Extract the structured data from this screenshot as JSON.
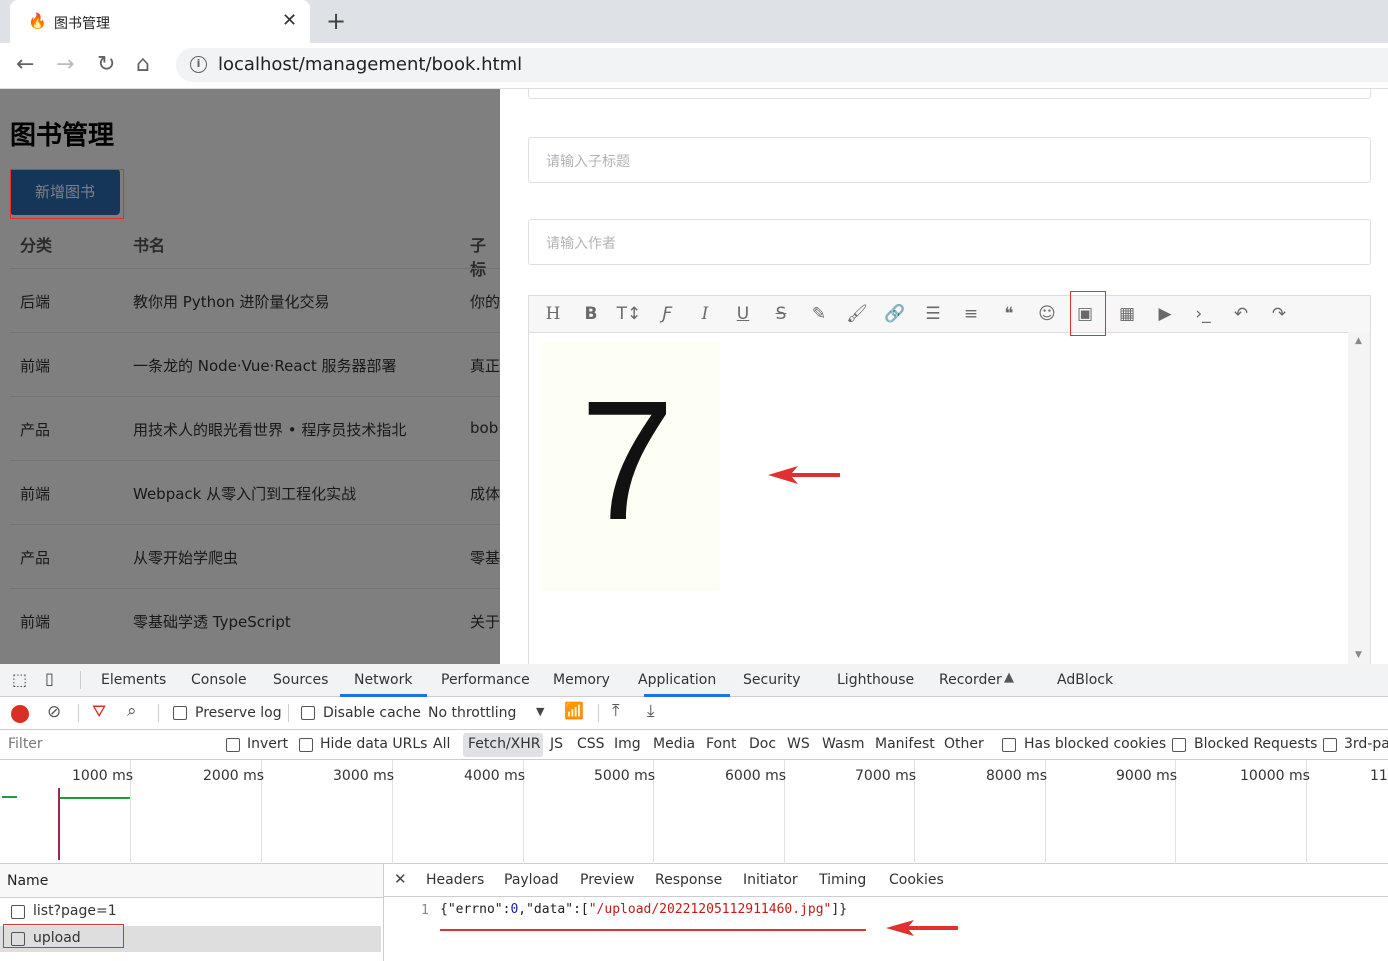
{
  "browser": {
    "tab_title": "图书管理",
    "url": "localhost/management/book.html"
  },
  "page": {
    "title": "图书管理",
    "add_button": "新增图书",
    "table": {
      "headers": [
        "分类",
        "书名",
        "子标"
      ],
      "rows": [
        {
          "category": "后端",
          "name": "教你用 Python 进阶量化交易",
          "sub": "你的"
        },
        {
          "category": "前端",
          "name": "一条龙的 Node·Vue·React 服务器部署",
          "sub": "真正"
        },
        {
          "category": "产品",
          "name": "用技术人的眼光看世界 • 程序员技术指北",
          "sub": "bob"
        },
        {
          "category": "前端",
          "name": "Webpack 从零入门到工程化实战",
          "sub": "成体"
        },
        {
          "category": "产品",
          "name": "从零开始学爬虫",
          "sub": "零基"
        },
        {
          "category": "前端",
          "name": "零基础学透 TypeScript",
          "sub": "关于"
        }
      ]
    },
    "form": {
      "subtitle_placeholder": "请输入子标题",
      "author_placeholder": "请输入作者"
    },
    "editor": {
      "toolbar": [
        "H",
        "B",
        "T↕",
        "Ƒ",
        "I",
        "U",
        "S",
        "✎",
        "🖌",
        "🔗",
        "☰",
        "≡",
        "❝",
        "☺",
        "▣",
        "▦",
        "▶",
        "›_",
        "↶",
        "↷"
      ],
      "image_content": "7"
    }
  },
  "devtools": {
    "tabs": [
      "Elements",
      "Console",
      "Sources",
      "Network",
      "Performance",
      "Memory",
      "Application",
      "Security",
      "Lighthouse",
      "Recorder",
      "AdBlock"
    ],
    "active_tab": "Network",
    "toolbar": {
      "preserve_log": "Preserve log",
      "disable_cache": "Disable cache",
      "throttling": "No throttling"
    },
    "filter": {
      "placeholder": "Filter",
      "invert": "Invert",
      "hide_data_urls": "Hide data URLs",
      "types": [
        "All",
        "Fetch/XHR",
        "JS",
        "CSS",
        "Img",
        "Media",
        "Font",
        "Doc",
        "WS",
        "Wasm",
        "Manifest",
        "Other"
      ],
      "has_blocked_cookies": "Has blocked cookies",
      "blocked_requests": "Blocked Requests",
      "third_party": "3rd-pa"
    },
    "timeline_labels": [
      "1000 ms",
      "2000 ms",
      "3000 ms",
      "4000 ms",
      "5000 ms",
      "6000 ms",
      "7000 ms",
      "8000 ms",
      "9000 ms",
      "10000 ms",
      "11"
    ],
    "requests_header": "Name",
    "requests": [
      "list?page=1",
      "upload"
    ],
    "response_tabs": [
      "Headers",
      "Payload",
      "Preview",
      "Response",
      "Initiator",
      "Timing",
      "Cookies"
    ],
    "active_response_tab": "Response",
    "response": {
      "line_number": "1",
      "prefix": "{\"errno\":",
      "errno_value": "0",
      "mid": ",\"data\":[",
      "data_value": "\"/upload/20221205112911460.jpg\"",
      "suffix": "]}"
    }
  },
  "colors": {
    "accent": "#1a73e8",
    "annotation": "#e03030",
    "button": "#2b6cb0"
  }
}
